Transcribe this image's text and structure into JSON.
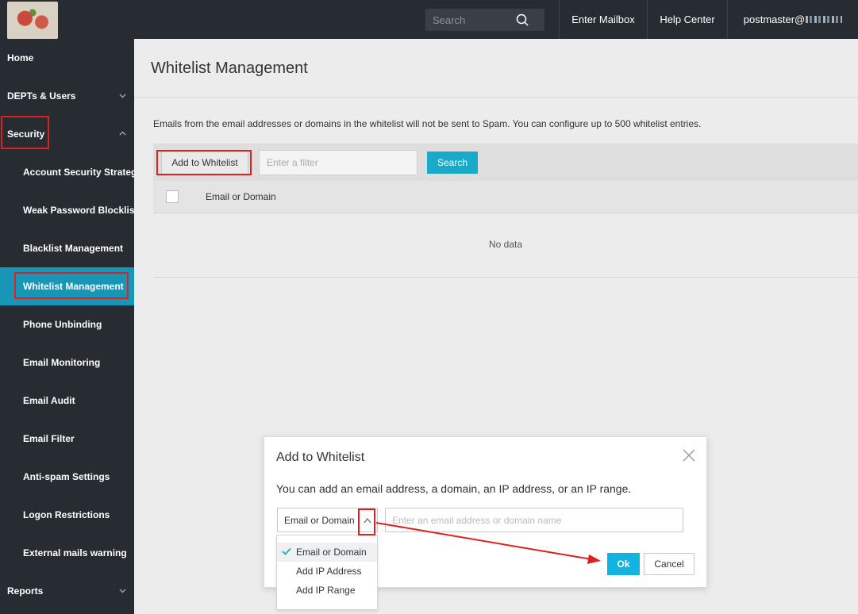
{
  "header": {
    "search_placeholder": "Search",
    "enter_mailbox": "Enter Mailbox",
    "help_center": "Help Center",
    "user": "postmaster@"
  },
  "sidebar": {
    "items": [
      {
        "label": "Home"
      },
      {
        "label": "DEPTs & Users"
      },
      {
        "label": "Security"
      },
      {
        "label": "Account Security Strategy"
      },
      {
        "label": "Weak Password Blocklist Settings"
      },
      {
        "label": "Blacklist Management"
      },
      {
        "label": "Whitelist Management"
      },
      {
        "label": "Phone Unbinding"
      },
      {
        "label": "Email Monitoring"
      },
      {
        "label": "Email Audit"
      },
      {
        "label": "Email Filter"
      },
      {
        "label": "Anti-spam Settings"
      },
      {
        "label": "Logon Restrictions"
      },
      {
        "label": "External mails warning"
      },
      {
        "label": "Reports"
      }
    ]
  },
  "main": {
    "title": "Whitelist Management",
    "description": "Emails from the email addresses or domains in the whitelist will not be sent to Spam. You can configure up to 500 whitelist entries.",
    "add_button": "Add to Whitelist",
    "filter_placeholder": "Enter a filter",
    "search_button": "Search",
    "column_header": "Email or Domain",
    "empty_text": "No data"
  },
  "modal": {
    "title": "Add to Whitelist",
    "description": "You can add an email address, a domain, an IP address, or an IP range.",
    "type_value": "Email or Domain",
    "input_placeholder": "Enter an email address or domain name",
    "ok": "Ok",
    "cancel": "Cancel",
    "options": [
      "Email or Domain",
      "Add IP Address",
      "Add IP Range"
    ]
  },
  "colors": {
    "accent": "#1aaac9",
    "sidebar_bg": "#272c33",
    "active_bg": "#1796b8",
    "highlight": "#e0201f"
  }
}
